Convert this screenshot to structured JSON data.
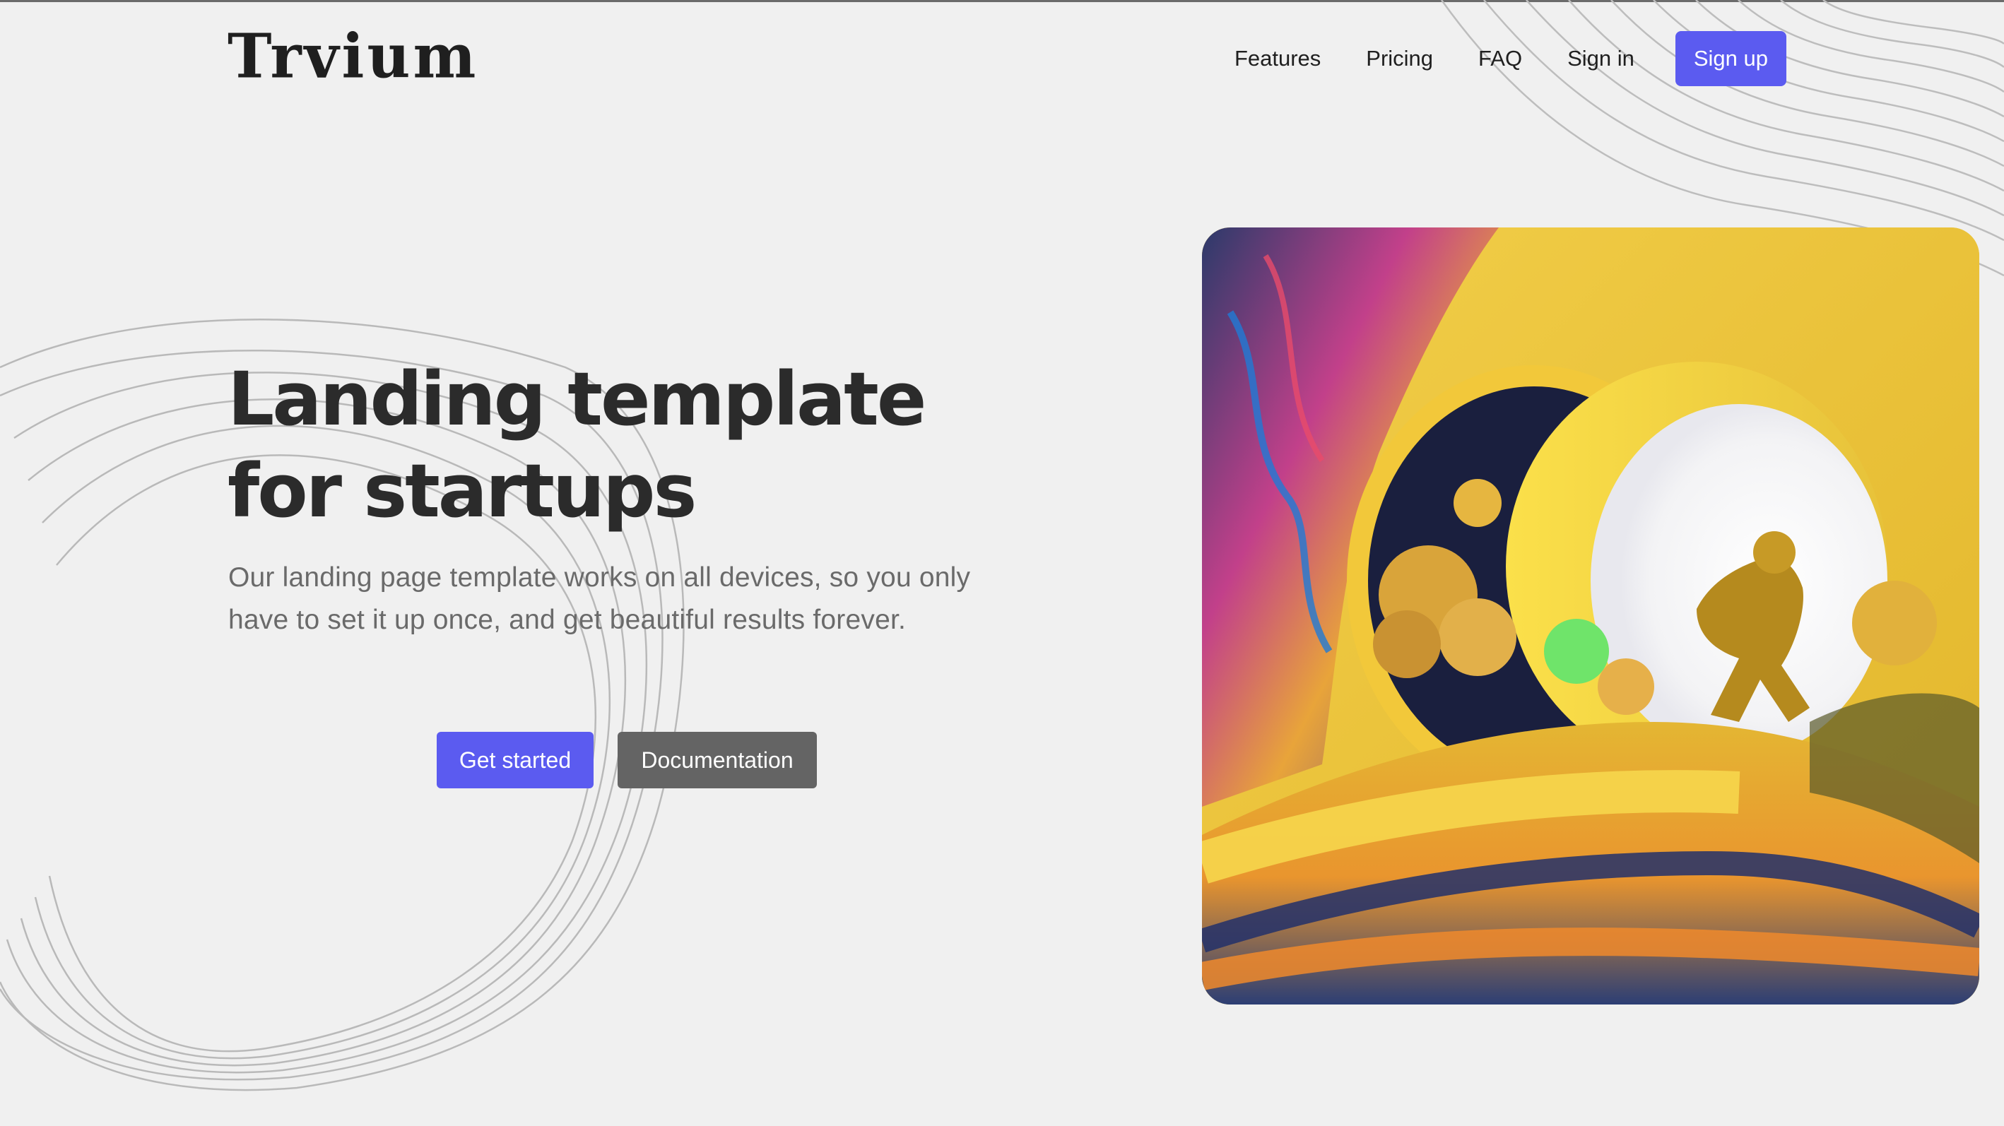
{
  "brand": {
    "logo_text": "Trvium",
    "accent_color": "#5b5bf0",
    "background_color": "#f0f0f0"
  },
  "nav": {
    "links": [
      {
        "label": "Features"
      },
      {
        "label": "Pricing"
      },
      {
        "label": "FAQ"
      },
      {
        "label": "Sign in"
      }
    ],
    "signup_label": "Sign up"
  },
  "hero": {
    "title": "Landing template for startups",
    "subtitle": "Our landing page template works on all devices, so you only have to set it up once, and get beautiful results forever.",
    "primary_cta": "Get started",
    "secondary_cta": "Documentation",
    "image_icon": "astronaut-illustration-icon"
  }
}
